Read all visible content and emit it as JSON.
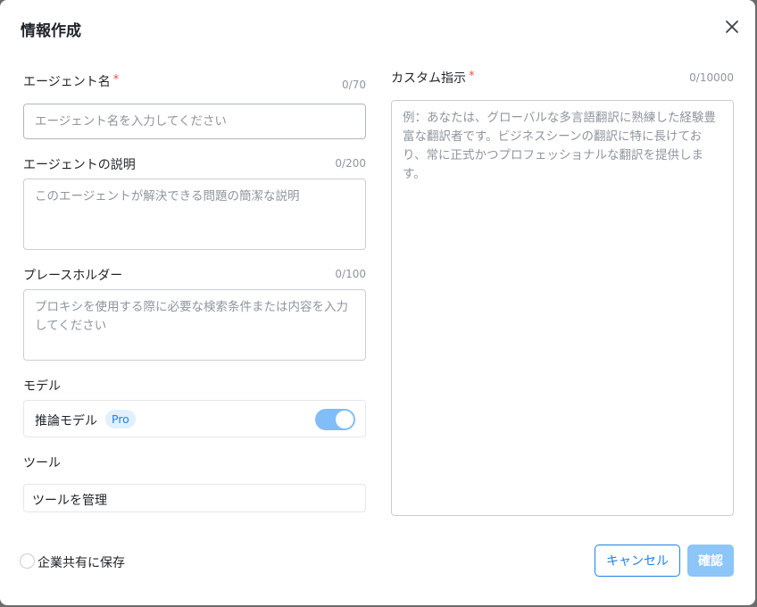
{
  "dialog": {
    "title": "情報作成"
  },
  "agent_name": {
    "label": "エージェント名",
    "required_mark": "*",
    "count": "0/70",
    "placeholder": "エージェント名を入力してください"
  },
  "agent_description": {
    "label": "エージェントの説明",
    "count": "0/200",
    "placeholder": "このエージェントが解決できる問題の簡潔な説明"
  },
  "placeholder_field": {
    "label": "プレースホルダー",
    "count": "0/100",
    "placeholder": "プロキシを使用する際に必要な検索条件または内容を入力してください"
  },
  "model": {
    "label": "モデル",
    "name": "推論モデル",
    "badge": "Pro",
    "enabled": true
  },
  "tools": {
    "label": "ツール",
    "manage_label": "ツールを管理"
  },
  "custom_instruction": {
    "label": "カスタム指示",
    "required_mark": "*",
    "count": "0/10000",
    "placeholder": "例：あなたは、グローバルな多言語翻訳に熟練した経験豊富な翻訳者です。ビジネスシーンの翻訳に特に長けており、常に正式かつプロフェッショナルな翻訳を提供します。"
  },
  "footer": {
    "save_enterprise_label": "企業共有に保存",
    "cancel_label": "キャンセル",
    "confirm_label": "確認"
  },
  "colors": {
    "accent": "#1e80e8",
    "required": "#f54a45",
    "toggle_on": "#81bdf6",
    "confirm_disabled": "#8cc5f7"
  },
  "icons": {
    "close": "close-icon"
  }
}
